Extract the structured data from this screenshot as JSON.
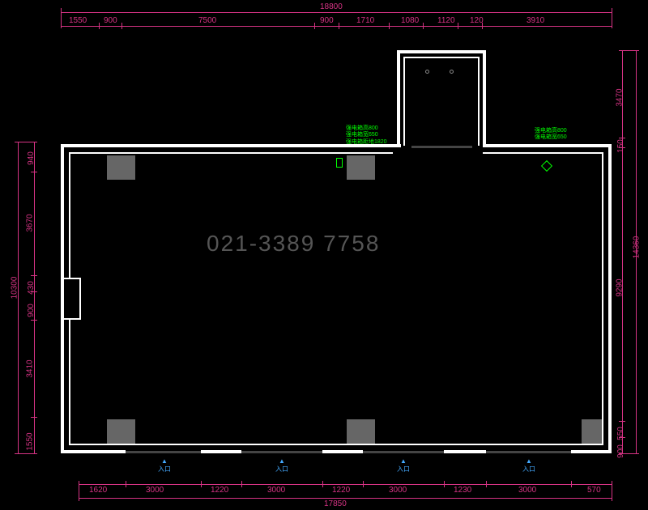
{
  "dims_top": {
    "total": "18800",
    "segs": [
      "1550",
      "900",
      "7500",
      "900",
      "1710",
      "1080",
      "1120",
      "120",
      "3910"
    ]
  },
  "dims_bottom": {
    "total": "17850",
    "segs": [
      "1620",
      "3000",
      "1220",
      "3000",
      "1220",
      "3000",
      "1230",
      "3000",
      "570"
    ]
  },
  "dims_left": {
    "total": "10300",
    "segs": [
      "940",
      "3670",
      "430",
      "900",
      "3410",
      "1550"
    ]
  },
  "dims_right": {
    "total": "14360",
    "segs": [
      "3470",
      "150",
      "9290",
      "550",
      "900"
    ]
  },
  "green_labels": {
    "box1": {
      "l1": "强电箱高800",
      "l2": "强电箱宽650",
      "l3": "强电箱距地1820"
    },
    "box2": {
      "l1": "强电箱高800",
      "l2": "强电箱宽650"
    }
  },
  "entrances": {
    "label": "入口"
  },
  "watermark": "021-3389 7758"
}
